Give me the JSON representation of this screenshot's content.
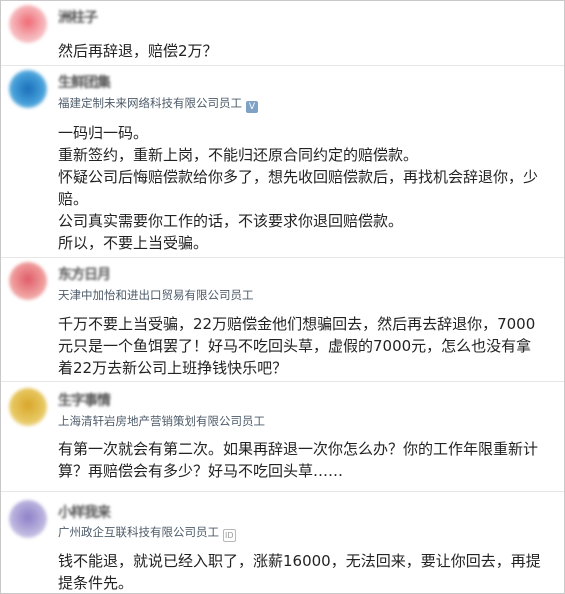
{
  "posts": [
    {
      "username": "洲柱子",
      "company": "",
      "badge": "",
      "avatar_color": "#f1b3b6",
      "lines": [
        "然后再辞退，赔偿2万？"
      ]
    },
    {
      "username": "生鲜团集",
      "company": "福建定制未来网络科技有限公司员工",
      "badge": "V",
      "avatar_color": "#3f9ad6",
      "lines": [
        "一码归一码。",
        "重新签约，重新上岗，不能归还原合同约定的赔偿款。",
        "怀疑公司后悔赔偿款给你多了，想先收回赔偿款后，再找机会辞退你，少赔。",
        "公司真实需要你工作的话，不该要求你退回赔偿款。",
        "所以，不要上当受骗。"
      ]
    },
    {
      "username": "东方日月",
      "company": "天津中加怡和进出口贸易有限公司员工",
      "badge": "",
      "avatar_color": "#ef9b9b",
      "lines": [
        "千万不要上当受骗，22万赔偿金他们想骗回去，然后再去辞退你，7000元只是一个鱼饵罢了！好马不吃回头草，虚假的7000元，怎么也没有拿着22万去新公司上班挣钱快乐吧？"
      ]
    },
    {
      "username": "生字事情",
      "company": "上海清轩岩房地产营销策划有限公司员工",
      "badge": "",
      "avatar_color": "#e6c65e",
      "lines": [
        "有第一次就会有第二次。如果再辞退一次你怎么办？你的工作年限重新计算？再赔偿会有多少？好马不吃回头草……"
      ]
    },
    {
      "username": "小样我来",
      "company": "广州政企互联科技有限公司员工",
      "badge": "ID",
      "avatar_color": "#b9b2dd",
      "lines": [
        "钱不能退，就说已经入职了，涨薪16000，无法回来，要让你回去，再提提条件先。"
      ]
    }
  ]
}
